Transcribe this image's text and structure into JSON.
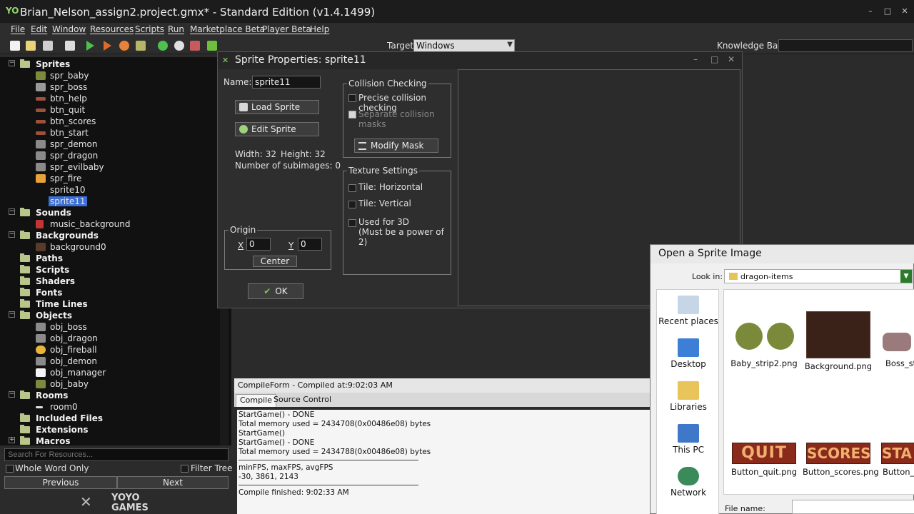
{
  "window": {
    "title": "Brian_Nelson_assign2.project.gmx*  -  Standard Edition (v1.4.1499)",
    "logo_text": "YO"
  },
  "menu": [
    "File",
    "Edit",
    "Window",
    "Resources",
    "Scripts",
    "Run",
    "Marketplace Beta",
    "Player Beta",
    "Help"
  ],
  "toolbar": {
    "target_label": "Target:",
    "target_value": "Windows",
    "knowledge_base_label": "Knowledge Base:"
  },
  "tree": {
    "sprites": {
      "label": "Sprites",
      "items": [
        "spr_baby",
        "spr_boss",
        "btn_help",
        "btn_quit",
        "btn_scores",
        "btn_start",
        "spr_demon",
        "spr_dragon",
        "spr_evilbaby",
        "spr_fire",
        "sprite10",
        "sprite11"
      ]
    },
    "sounds": {
      "label": "Sounds",
      "items": [
        "music_background"
      ]
    },
    "backgrounds": {
      "label": "Backgrounds",
      "items": [
        "background0"
      ]
    },
    "paths": "Paths",
    "scripts": "Scripts",
    "shaders": "Shaders",
    "fonts": "Fonts",
    "timelines": "Time Lines",
    "objects": {
      "label": "Objects",
      "items": [
        "obj_boss",
        "obj_dragon",
        "obj_fireball",
        "obj_demon",
        "obj_manager",
        "obj_baby"
      ]
    },
    "rooms": {
      "label": "Rooms",
      "items": [
        "room0"
      ]
    },
    "included_files": "Included Files",
    "extensions": "Extensions",
    "macros": "Macros"
  },
  "search": {
    "placeholder": "Search For Resources...",
    "whole_word": "Whole Word Only",
    "filter_tree": "Filter Tree",
    "previous": "Previous",
    "next": "Next"
  },
  "brand": {
    "yoyo": "YOYO",
    "games": "GAMES"
  },
  "sprite_props": {
    "title": "Sprite Properties: sprite11",
    "name_label": "Name:",
    "name_value": "sprite11",
    "load_sprite": "Load Sprite",
    "edit_sprite": "Edit Sprite",
    "width": "Width: 32",
    "height": "Height: 32",
    "subimages": "Number of subimages: 0",
    "collision": {
      "legend": "Collision Checking",
      "precise": "Precise collision checking",
      "separate": "Separate collision masks",
      "modify_mask": "Modify Mask"
    },
    "texture": {
      "legend": "Texture Settings",
      "tile_h": "Tile: Horizontal",
      "tile_v": "Tile: Vertical",
      "used_3d": "Used for 3D",
      "power2": "(Must be a power of 2)"
    },
    "origin": {
      "legend": "Origin",
      "x_label": "X",
      "x_value": "0",
      "y_label": "Y",
      "y_value": "0",
      "center": "Center"
    },
    "ok": "OK"
  },
  "compile": {
    "title": "CompileForm - Compiled at:9:02:03 AM",
    "tab_compile": "Compile",
    "tab_source": "Source Control",
    "lines_a": [
      "StartGame() - DONE",
      "Total memory used = 2434708(0x00486e08) bytes",
      "StartGame()",
      "StartGame() - DONE",
      "Total memory used = 2434788(0x00486e08) bytes"
    ],
    "lines_b": [
      "minFPS, maxFPS, avgFPS",
      "-30, 3861, 2143"
    ],
    "finished": "Compile finished: 9:02:33 AM"
  },
  "open_dialog": {
    "title": "Open a Sprite Image",
    "look_in_label": "Look in:",
    "look_in_value": "dragon-items",
    "places": [
      "Recent places",
      "Desktop",
      "Libraries",
      "This PC",
      "Network"
    ],
    "files": [
      "Baby_strip2.png",
      "Background.png",
      "Boss_str",
      "Button_quit.png",
      "Button_scores.png",
      "Button_s"
    ],
    "thumb_text": [
      "QUIT",
      "SCORES",
      "STA"
    ],
    "file_name_label": "File name:"
  },
  "colors": {
    "selection": "#3b6fd6",
    "run_green": "#4ec04e",
    "background": "#2b2b2b"
  }
}
